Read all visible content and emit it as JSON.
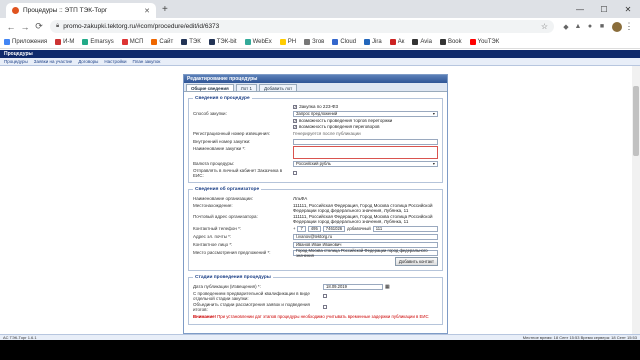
{
  "browser": {
    "tab_title": "Процедуры :: ЭТП ТЭК-Торг",
    "url": "promo-zakupki.tektorg.ru/#com/procedure/edit/id/6373",
    "bookmarks": [
      "Приложения",
      "И-М",
      "Emarsys",
      "МСП",
      "Сайт",
      "ТЭК",
      "ТЭК-bit",
      "WebEx",
      "РН",
      "Згов",
      "Cloud",
      "Jira",
      "Ак",
      "Avia",
      "Book",
      "YouТЭК"
    ]
  },
  "app": {
    "header_title": "Процедуры",
    "menu": [
      "Процедуры",
      "Заявки на участие",
      "Договоры",
      "Настройки",
      "План закупок"
    ]
  },
  "panel": {
    "title": "Редактирование процедуры",
    "tabs": [
      "Общие сведения",
      "Лот 1",
      "Добавить лот"
    ]
  },
  "section1": {
    "legend": "Сведения о процедуре",
    "law_label": "Закупка по 223-ФЗ",
    "method_label": "Способ закупки:",
    "method_value": "Запрос предложений",
    "opt1": "возможность проведения торгов переторжки",
    "opt2": "возможность проведения переговоров",
    "regnum_label": "Регистрационный номер извещения:",
    "regnum_value": "Генерируется после публикации",
    "internal_label": "Внутренний номер закупки:",
    "name_label": "Наименование закупки *:",
    "currency_label": "Валюта процедуры:",
    "currency_value": "Российский рубль",
    "eis_label": "Отправлять в личный кабинет Заказчика в ЕИС:"
  },
  "section2": {
    "legend": "Сведения об организаторе",
    "org_label": "Наименование организации:",
    "org_value": "ЛльФА",
    "loc_label": "Местонахождение:",
    "loc_value": "111111, Российская Федерация, Город Москва столица Российской Федерации город федерального значения, Лубянка, 11",
    "post_label": "Почтовый адрес организатора:",
    "post_value": "111111, Российская Федерация, Город Москва столица Российской Федерации город федерального значения, Лубянка, 11",
    "phone_label": "Контактный телефон *:",
    "phone_plus": "+",
    "phone_cc": "7",
    "phone_code": "495",
    "phone_num": "7461026",
    "phone_ext_label": "добавочный",
    "phone_ext": "111",
    "email_label": "Адрес эл. почты *:",
    "email_value": "l.ivanov@tektorg.ru",
    "contact_label": "Контактное лицо *:",
    "contact_value": "Иванов Иван Иванович",
    "place_label": "Место рассмотрения предложений *:",
    "place_value": "Город Москва столица Российской Федерации город федерального значения",
    "add_contact_btn": "Добавить контакт"
  },
  "section3": {
    "legend": "Стадии проведения процедуры",
    "pubdate_label": "Дата публикации (Извещения) *:",
    "pubdate_value": "18.09.2019",
    "prequal_label": "С проведением предварительной квалификации в виде отдельной стадии закупки:",
    "merge_label": "Объединить стадии рассмотрения заявок и подведения итогов:",
    "warn_bold": "Внимание!",
    "warn_text": "При установлении дат этапов процедуры необходимо учитывать временные задержки публикации в ЕИС"
  },
  "status": {
    "left": "АС ТЭК-Торг 1.6.1",
    "right": "Местное время: 18 Сент 15:53 Время сервера: 18 Сент 15:53"
  }
}
